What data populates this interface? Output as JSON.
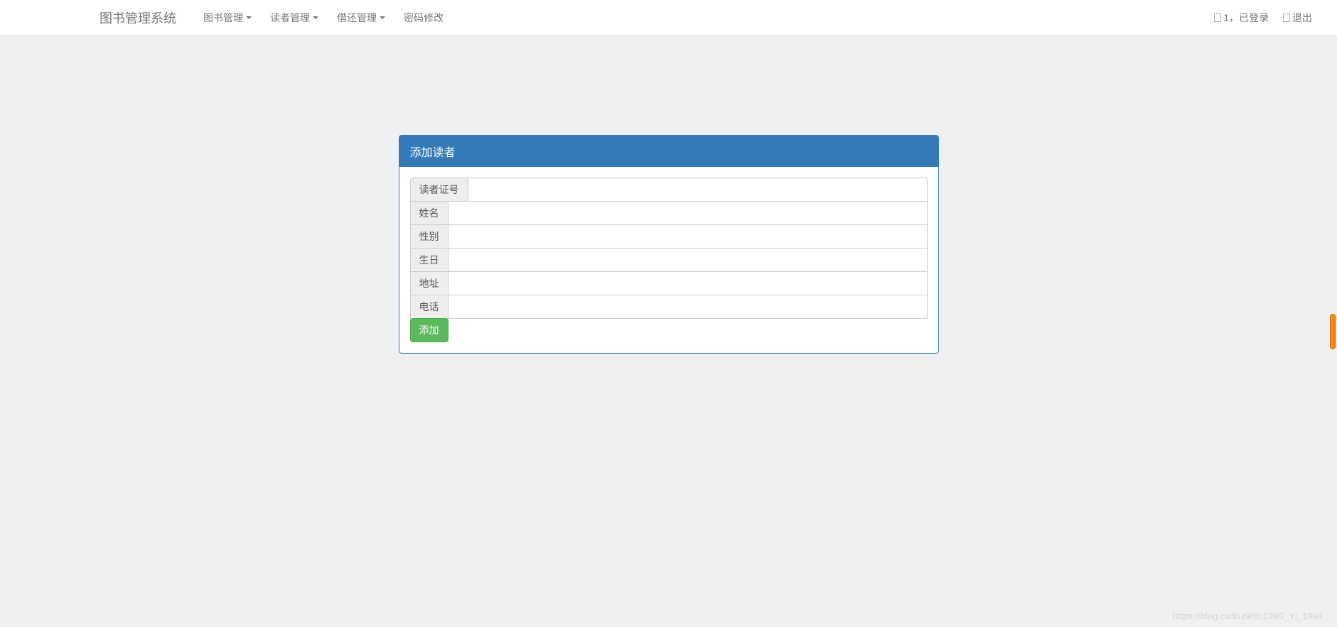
{
  "navbar": {
    "brand": "图书管理系统",
    "menu": [
      {
        "label": "图书管理",
        "hasDropdown": true
      },
      {
        "label": "读者管理",
        "hasDropdown": true
      },
      {
        "label": "借还管理",
        "hasDropdown": true
      },
      {
        "label": "密码修改",
        "hasDropdown": false
      }
    ],
    "userStatus": "1，已登录",
    "logout": "退出"
  },
  "panel": {
    "title": "添加读者",
    "fields": [
      {
        "label": "读者证号",
        "name": "reader-id"
      },
      {
        "label": "姓名",
        "name": "name"
      },
      {
        "label": "性别",
        "name": "gender"
      },
      {
        "label": "生日",
        "name": "birthday"
      },
      {
        "label": "地址",
        "name": "address"
      },
      {
        "label": "电话",
        "name": "phone"
      }
    ],
    "submitLabel": "添加"
  },
  "watermark": "https://blog.csdn.net/LONG_Yi_1994"
}
